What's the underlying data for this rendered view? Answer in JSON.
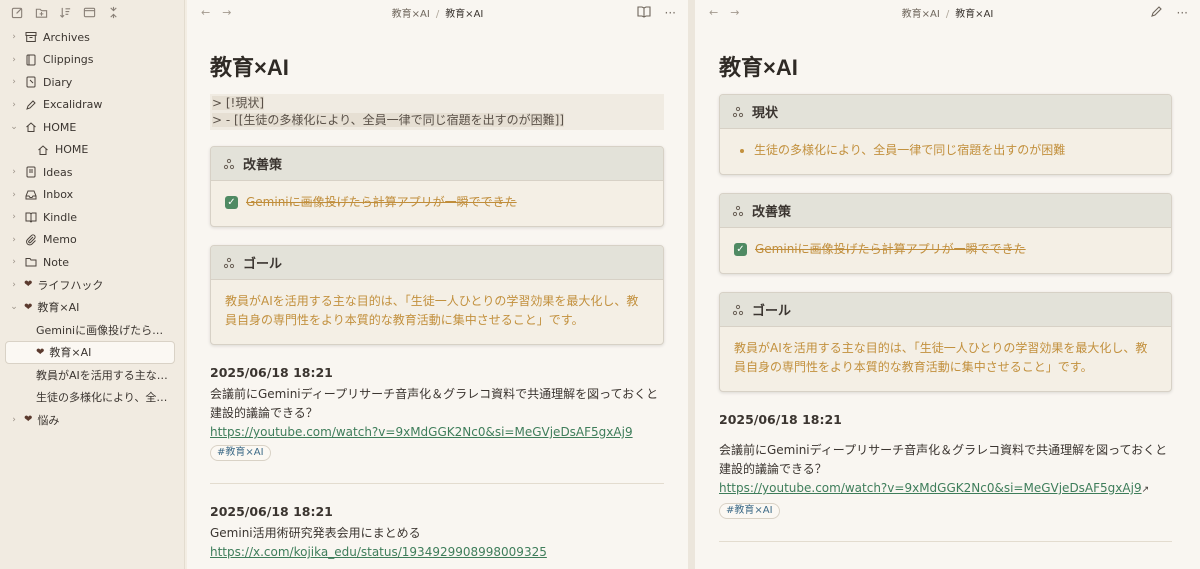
{
  "sidebar": {
    "items": [
      {
        "label": "Archives",
        "icon": "archive-icon",
        "type": "folder"
      },
      {
        "label": "Clippings",
        "icon": "book-icon",
        "type": "folder"
      },
      {
        "label": "Diary",
        "icon": "notebook-icon",
        "type": "folder"
      },
      {
        "label": "Excalidraw",
        "icon": "pen-icon",
        "type": "folder"
      },
      {
        "label": "HOME",
        "icon": "home-icon",
        "type": "folder-open"
      },
      {
        "label": "HOME",
        "icon": "home-icon",
        "type": "child"
      },
      {
        "label": "Ideas",
        "icon": "lightbulb-icon",
        "type": "folder"
      },
      {
        "label": "Inbox",
        "icon": "inbox-icon",
        "type": "folder"
      },
      {
        "label": "Kindle",
        "icon": "kindle-icon",
        "type": "folder"
      },
      {
        "label": "Memo",
        "icon": "paperclip-icon",
        "type": "folder"
      },
      {
        "label": "Note",
        "icon": "folder-icon",
        "type": "folder"
      },
      {
        "label": "ライフハック",
        "icon": "heart-icon",
        "type": "folder"
      },
      {
        "label": "教育×AI",
        "icon": "heart-icon",
        "type": "folder-open"
      },
      {
        "label": "Geminiに画像投げたら計算...",
        "icon": "",
        "type": "child"
      },
      {
        "label": "教育×AI",
        "icon": "heart-icon",
        "type": "child-active"
      },
      {
        "label": "教員がAIを活用する主な目...",
        "icon": "",
        "type": "child"
      },
      {
        "label": "生徒の多様化により、全員...",
        "icon": "",
        "type": "child"
      },
      {
        "label": "悩み",
        "icon": "heart-icon",
        "type": "folder"
      }
    ]
  },
  "left_pane": {
    "breadcrumb_parent": "教育×AI",
    "breadcrumb_current": "教育×AI",
    "title": "教育×AI",
    "raw_line1": "> [!現状]",
    "raw_line2": ">  - [[生徒の多様化により、全員一律で同じ宿題を出すのが困難]]",
    "callout1_title": "改善策",
    "callout1_task": "Geminiに画像投げたら計算アプリが一瞬でできた",
    "callout2_title": "ゴール",
    "callout2_text": "教員がAIを活用する主な目的は、「生徒一人ひとりの学習効果を最大化し、教員自身の専門性をより本質的な教育活動に集中させること」です。",
    "entry1_date": "2025/06/18 18:21",
    "entry1_text": "会議前にGeminiディープリサーチ音声化＆グラレコ資料で共通理解を図っておくと建設的議論できる？",
    "entry1_link": "https://youtube.com/watch?v=9xMdGGK2Nc0&si=MeGVjeDsAF5gxAj9",
    "entry1_tag": "#教育×AI",
    "entry2_date": "2025/06/18 18:21",
    "entry2_text": "Gemini活用術研究発表会用にまとめる",
    "entry2_link": "https://x.com/kojika_edu/status/1934929908998009325"
  },
  "right_pane": {
    "breadcrumb_parent": "教育×AI",
    "breadcrumb_current": "教育×AI",
    "title": "教育×AI",
    "callout0_title": "現状",
    "callout0_item": "生徒の多様化により、全員一律で同じ宿題を出すのが困難",
    "callout1_title": "改善策",
    "callout1_task": "Geminiに画像投げたら計算アプリが一瞬でできた",
    "callout2_title": "ゴール",
    "callout2_text": "教員がAIを活用する主な目的は、「生徒一人ひとりの学習効果を最大化し、教員自身の専門性をより本質的な教育活動に集中させること」です。",
    "entry1_date": "2025/06/18 18:21",
    "entry1_text": "会議前にGeminiディープリサーチ音声化＆グラレコ資料で共通理解を図っておくと建設的議論できる？",
    "entry1_link": "https://youtube.com/watch?v=9xMdGGK2Nc0&si=MeGVjeDsAF5gxAj9",
    "entry1_tag": "#教育×AI"
  },
  "colors": {
    "accent_gold": "#c2903d",
    "link_green": "#3e7d5a",
    "checkbox_green": "#4f8a63"
  }
}
